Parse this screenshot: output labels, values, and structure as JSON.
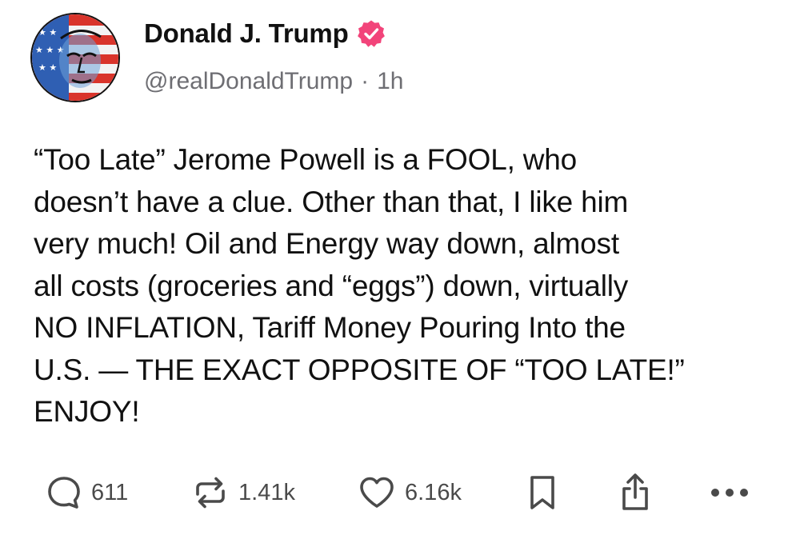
{
  "author": {
    "display_name": "Donald J. Trump",
    "handle": "@realDonaldTrump",
    "separator": "·",
    "time_ago": "1h",
    "verified_color": "#f2447a",
    "avatar_icon": "avatar-image"
  },
  "post": {
    "lines": [
      "“Too Late” Jerome Powell is a FOOL, who",
      "doesn’t have a clue. Other than that, I like him",
      "very much! Oil and Energy way down, almost",
      "all costs (groceries and “eggs”) down, virtually",
      "NO INFLATION, Tariff Money Pouring Into the",
      "U.S. — THE EXACT OPPOSITE OF “TOO LATE!”",
      "ENJOY!"
    ]
  },
  "actions": {
    "reply": {
      "icon": "reply-icon",
      "count": "611"
    },
    "repost": {
      "icon": "repost-icon",
      "count": "1.41k"
    },
    "like": {
      "icon": "heart-icon",
      "count": "6.16k"
    },
    "bookmark": {
      "icon": "bookmark-icon"
    },
    "share": {
      "icon": "share-icon"
    },
    "more": {
      "icon": "more-icon"
    }
  },
  "colors": {
    "text": "#111111",
    "secondary_text": "#6e6e73",
    "icon": "#4a4a4a"
  }
}
